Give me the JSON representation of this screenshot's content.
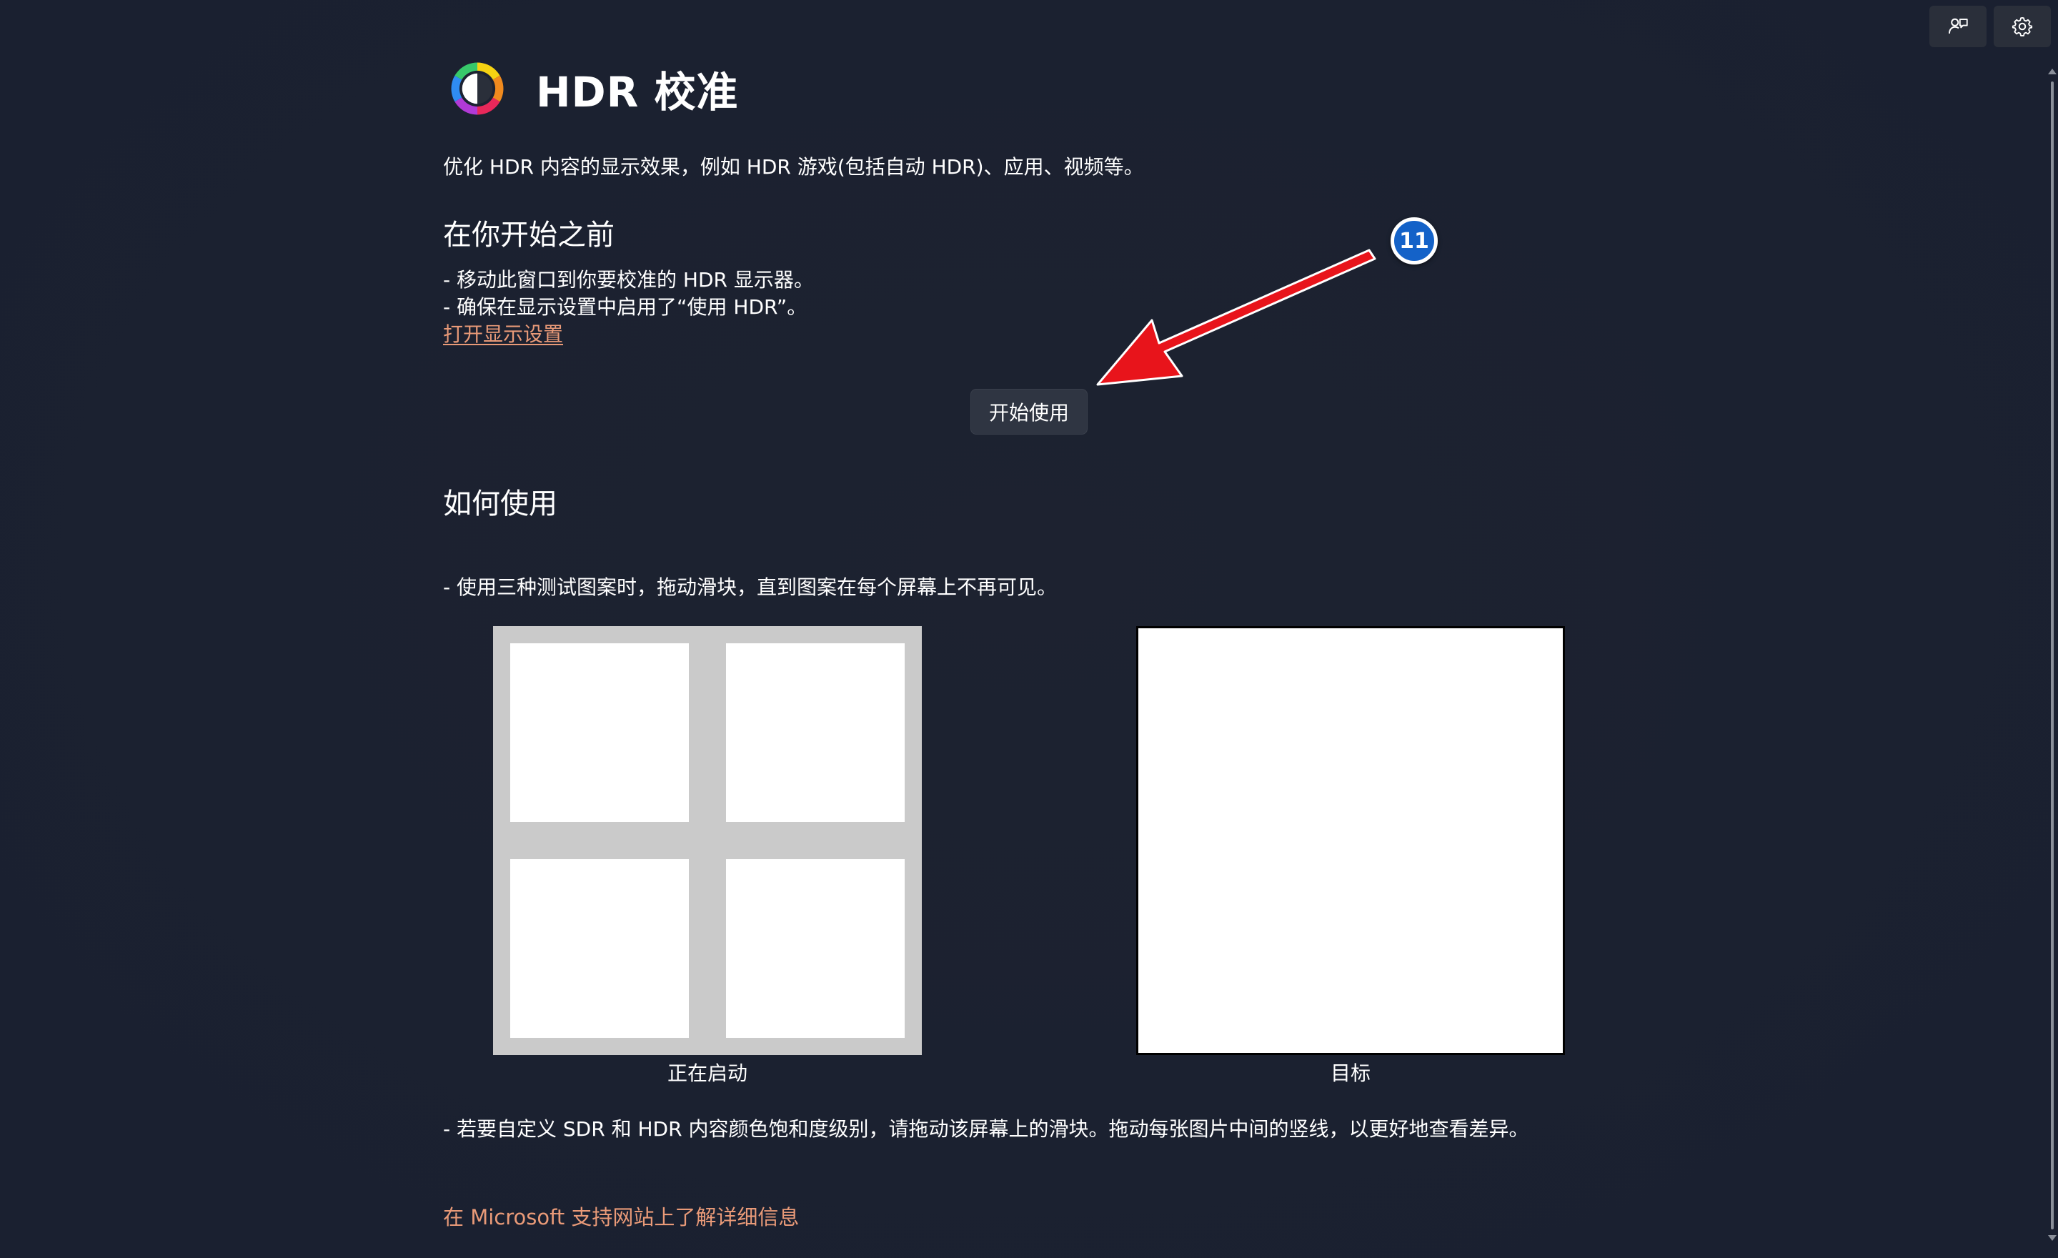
{
  "window": {
    "buttons": [
      {
        "name": "feedback",
        "icon": "feedback-icon"
      },
      {
        "name": "settings",
        "icon": "gear-icon"
      }
    ]
  },
  "header": {
    "icon": "color-wheel-icon",
    "title": "HDR 校准"
  },
  "intro": {
    "subtitle": "优化 HDR 内容的显示效果，例如 HDR 游戏(包括自动 HDR)、应用、视频等。"
  },
  "before_start": {
    "heading": "在你开始之前",
    "bullets": [
      "- 移动此窗口到你要校准的 HDR 显示器。",
      "- 确保在显示设置中启用了“使用 HDR”。"
    ],
    "link": "打开显示设置",
    "start_button": "开始使用"
  },
  "how_to": {
    "heading": "如何使用",
    "bullet": "- 使用三种测试图案时，拖动滑块，直到图案在每个屏幕上不再可见。",
    "images": [
      {
        "caption": "正在启动"
      },
      {
        "caption": "目标"
      }
    ],
    "saturation_bullet": "- 若要自定义 SDR 和 HDR 内容颜色饱和度级别，请拖动该屏幕上的滑块。拖动每张图片中间的竖线，以更好地查看差异。",
    "learn_more_link": "在 Microsoft 支持网站上了解详细信息"
  },
  "annotation": {
    "step_number": "11",
    "color": "#e8141b",
    "badge_color": "#1462c8"
  },
  "colors": {
    "background": "#1c2231",
    "link": "#e99a78",
    "button_bg": "#2f3542"
  }
}
